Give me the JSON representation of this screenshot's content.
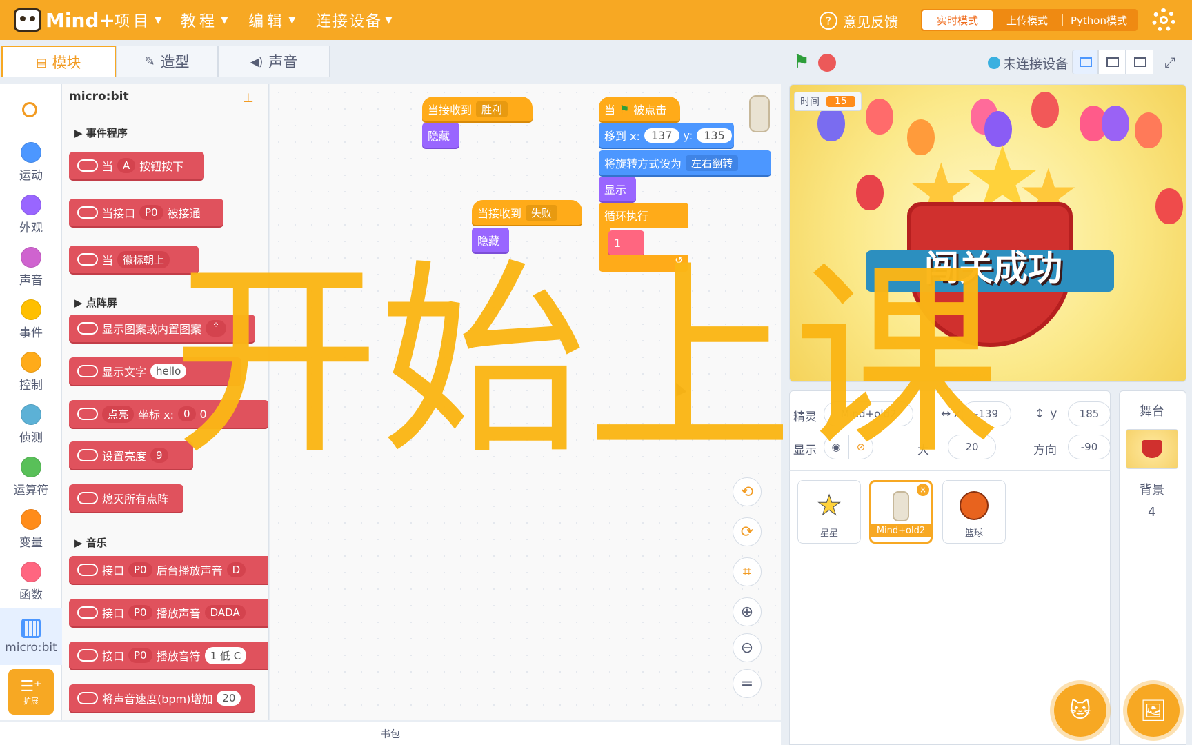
{
  "app": {
    "logo": "Mind+"
  },
  "menu": {
    "items": [
      {
        "label": "项目"
      },
      {
        "label": "教程"
      },
      {
        "label": "编辑"
      },
      {
        "label": "连接设备"
      }
    ],
    "feedback": "意见反馈",
    "modes": [
      "实时模式",
      "上传模式",
      "Python模式"
    ]
  },
  "tabs": [
    {
      "label": "模块"
    },
    {
      "label": "造型"
    },
    {
      "label": "声音"
    }
  ],
  "categories": [
    {
      "label": "运动",
      "color": "#4c97ff"
    },
    {
      "label": "外观",
      "color": "#9966ff"
    },
    {
      "label": "声音",
      "color": "#cf63cf"
    },
    {
      "label": "事件",
      "color": "#ffbf00"
    },
    {
      "label": "控制",
      "color": "#ffab19"
    },
    {
      "label": "侦测",
      "color": "#5cb1d6"
    },
    {
      "label": "运算符",
      "color": "#59c059"
    },
    {
      "label": "变量",
      "color": "#ff8c1a"
    },
    {
      "label": "函数",
      "color": "#ff6680"
    },
    {
      "label": "micro:bit",
      "color": "#4c97ff"
    }
  ],
  "extension_label": "扩展",
  "palette": {
    "title": "micro:bit",
    "sections": {
      "events": "事件程序",
      "display": "点阵屏",
      "music": "音乐"
    },
    "blocks": {
      "b1": {
        "pre": "当",
        "pill": "A",
        "post": "按钮按下"
      },
      "b2": {
        "pre": "当接口",
        "pill": "P0",
        "post": "被接通"
      },
      "b3": {
        "pre": "当",
        "pill": "徽标朝上"
      },
      "b4": {
        "pre": "显示图案或内置图案"
      },
      "b5": {
        "pre": "显示文字",
        "field": "hello"
      },
      "b6": {
        "pill": "点亮",
        "mid": "坐标 x:",
        "field": "0",
        "tail": "0"
      },
      "b7": {
        "pre": "设置亮度",
        "pill": "9"
      },
      "b8": {
        "pre": "熄灭所有点阵"
      },
      "b9": {
        "pre": "接口",
        "pill": "P0",
        "post": "后台播放声音",
        "tail": "D"
      },
      "b10": {
        "pre": "接口",
        "pill": "P0",
        "post": "播放声音",
        "tail": "DADA"
      },
      "b11": {
        "pre": "接口",
        "pill": "P0",
        "post": "播放音符",
        "field": "1 低 C"
      },
      "b12": {
        "pre": "将声音速度(bpm)增加",
        "field": "20"
      }
    }
  },
  "workspace": {
    "s1": {
      "hat": "当接收到",
      "msg": "胜利",
      "action": "隐藏"
    },
    "s2": {
      "hat": "当接收到",
      "msg": "失败",
      "action": "隐藏"
    },
    "s3": {
      "hat_pre": "当",
      "hat_post": "被点击",
      "move": "移到 x:",
      "x": "137",
      "ylabel": "y:",
      "y": "135",
      "rot": "将旋转方式设为",
      "rot_value": "左右翻转",
      "show": "显示",
      "loop": "循环执行",
      "inner": "1"
    }
  },
  "bag_label": "书包",
  "stage": {
    "status": "未连接设备",
    "timer_label": "时间",
    "timer_value": "15",
    "banner_text": "闯关成功"
  },
  "sprite_info": {
    "sprite_label": "精灵",
    "sprite_name": "Mind+old2",
    "x_label": "x",
    "x": "-139",
    "y_label": "y",
    "y": "185",
    "show_label": "显示",
    "size_label": "大",
    "size": "20",
    "dir_label": "方向",
    "direction": "-90"
  },
  "sprites": [
    {
      "name": "星星"
    },
    {
      "name": "Mind+old2"
    },
    {
      "name": "篮球"
    }
  ],
  "stage_panel": {
    "title": "舞台",
    "backdrop_label": "背景",
    "backdrop_count": "4"
  },
  "overlay_text": "开始上课"
}
